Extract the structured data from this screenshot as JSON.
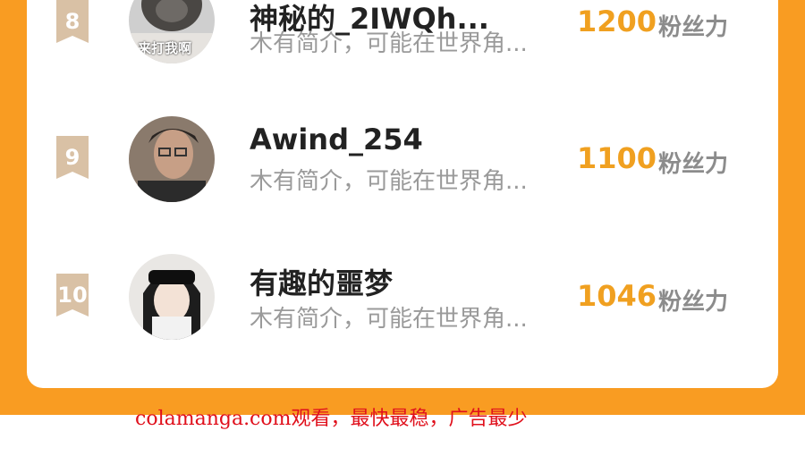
{
  "ranking": {
    "entries": [
      {
        "rank": "8",
        "name": "神秘的_2IWQh...",
        "bio": "木有简介，可能在世界角...",
        "fans": "1200",
        "fans_label": "粉丝力",
        "avatar_caption": "来打我啊"
      },
      {
        "rank": "9",
        "name": "Awind_254",
        "bio": "木有简介，可能在世界角...",
        "fans": "1100",
        "fans_label": "粉丝力"
      },
      {
        "rank": "10",
        "name": "有趣的噩梦",
        "bio": "木有简介，可能在世界角...",
        "fans": "1046",
        "fans_label": "粉丝力"
      }
    ]
  },
  "watermark": {
    "text": "colamanga.com观看，最快最稳，广告最少"
  },
  "colors": {
    "background_band": "#f99c22",
    "fans_value": "#f0a020",
    "rank_badge": "#d9c1a5",
    "watermark": "#e0101c"
  }
}
